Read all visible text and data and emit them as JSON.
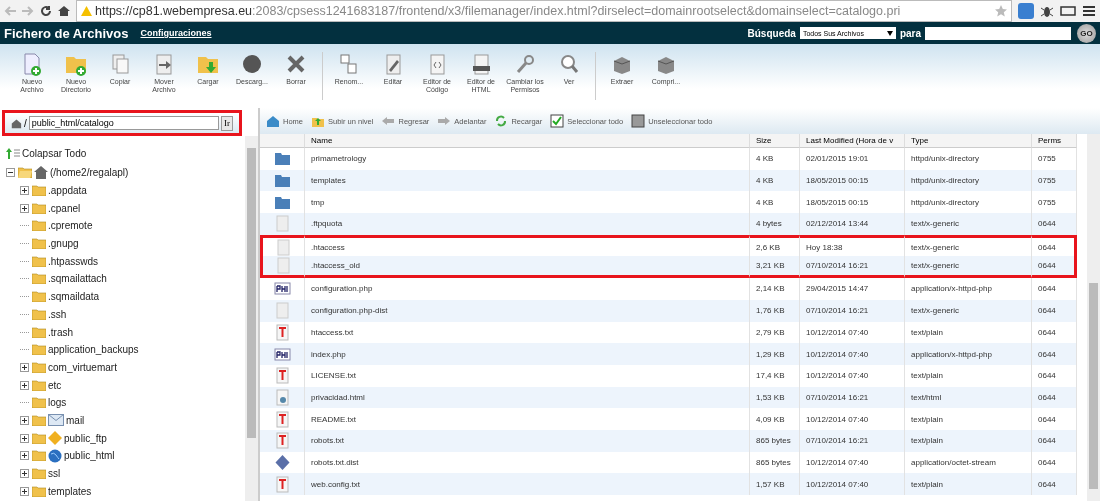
{
  "browser": {
    "url_host": "https://cp81.webempresa.eu",
    "url_rest": ":2083/cpsess1241683187/frontend/x3/filemanager/index.html?dirselect=domainrootselect&domainselect=catalogo.pri"
  },
  "header": {
    "title": "Fichero de Archivos",
    "settings_link": "Configuraciones",
    "search_label": "Búsqueda",
    "search_scope": "Todos Sus Archivos",
    "for_label": "para",
    "go": "GO"
  },
  "toolbar": [
    [
      {
        "kind": "new-file",
        "label": "Nuevo Archivo"
      },
      {
        "kind": "new-folder",
        "label": "Nuevo Directorio"
      },
      {
        "kind": "copy",
        "label": "Copiar"
      },
      {
        "kind": "move",
        "label": "Mover Archivo"
      },
      {
        "kind": "upload",
        "label": "Cargar"
      },
      {
        "kind": "download",
        "label": "Descarg..."
      },
      {
        "kind": "delete",
        "label": "Borrar"
      }
    ],
    [
      {
        "kind": "rename",
        "label": "Renom..."
      },
      {
        "kind": "edit",
        "label": "Editar"
      },
      {
        "kind": "code",
        "label": "Editor de Código"
      },
      {
        "kind": "html",
        "label": "Editor de HTML"
      },
      {
        "kind": "perms",
        "label": "Cambiar los Permisos"
      },
      {
        "kind": "view",
        "label": "Ver"
      }
    ],
    [
      {
        "kind": "extract",
        "label": "Extraer"
      },
      {
        "kind": "compress",
        "label": "Compri..."
      }
    ]
  ],
  "path_box": {
    "prefix": "/",
    "value": "public_html/catalogo",
    "go": "Ir",
    "highlighted": true
  },
  "tree": {
    "collapse_all": "Colapsar Todo",
    "root": {
      "label": "(/home2/regalapl)",
      "expanded": true,
      "children": [
        {
          "label": ".appdata",
          "kind": "folder",
          "expandable": true
        },
        {
          "label": ".cpanel",
          "kind": "folder",
          "expandable": true
        },
        {
          "label": ".cpremote",
          "kind": "folder",
          "expandable": false
        },
        {
          "label": ".gnupg",
          "kind": "folder",
          "expandable": false
        },
        {
          "label": ".htpasswds",
          "kind": "folder",
          "expandable": false
        },
        {
          "label": ".sqmailattach",
          "kind": "folder",
          "expandable": false
        },
        {
          "label": ".sqmaildata",
          "kind": "folder",
          "expandable": false
        },
        {
          "label": ".ssh",
          "kind": "folder",
          "expandable": false
        },
        {
          "label": ".trash",
          "kind": "folder",
          "expandable": false
        },
        {
          "label": "application_backups",
          "kind": "folder",
          "expandable": false
        },
        {
          "label": "com_virtuemart",
          "kind": "folder",
          "expandable": true
        },
        {
          "label": "etc",
          "kind": "folder",
          "expandable": true
        },
        {
          "label": "logs",
          "kind": "folder",
          "expandable": false
        },
        {
          "label": "mail",
          "kind": "mail",
          "expandable": true
        },
        {
          "label": "public_ftp",
          "kind": "ftp",
          "expandable": true
        },
        {
          "label": "public_html",
          "kind": "web",
          "expandable": true
        },
        {
          "label": "ssl",
          "kind": "folder",
          "expandable": true
        },
        {
          "label": "templates",
          "kind": "folder",
          "expandable": true
        }
      ]
    }
  },
  "nav": [
    {
      "kind": "home",
      "label": "Home"
    },
    {
      "kind": "up",
      "label": "Subir un nivel"
    },
    {
      "kind": "back",
      "label": "Regresar"
    },
    {
      "kind": "forward",
      "label": "Adelantar"
    },
    {
      "kind": "reload",
      "label": "Recargar"
    },
    {
      "kind": "select-all",
      "label": "Seleccionar todo"
    },
    {
      "kind": "unselect-all",
      "label": "Unseleccionar todo"
    }
  ],
  "table": {
    "columns": [
      "Name",
      "Size",
      "Last Modified (Hora de v",
      "Type",
      "Perms"
    ],
    "rows": [
      {
        "kind": "folder",
        "name": "primametrology",
        "size": "4 KB",
        "modified": "02/01/2015 19:01",
        "type": "httpd/unix-directory",
        "perms": "0755",
        "highlighted": false
      },
      {
        "kind": "folder",
        "name": "templates",
        "size": "4 KB",
        "modified": "18/05/2015 00:15",
        "type": "httpd/unix-directory",
        "perms": "0755",
        "highlighted": false
      },
      {
        "kind": "folder",
        "name": "tmp",
        "size": "4 KB",
        "modified": "18/05/2015 00:15",
        "type": "httpd/unix-directory",
        "perms": "0755",
        "highlighted": false
      },
      {
        "kind": "generic",
        "name": ".ftpquota",
        "size": "4 bytes",
        "modified": "02/12/2014 13:44",
        "type": "text/x-generic",
        "perms": "0644",
        "highlighted": false
      },
      {
        "kind": "generic",
        "name": ".htaccess",
        "size": "2,6 KB",
        "modified": "Hoy 18:38",
        "type": "text/x-generic",
        "perms": "0644",
        "highlighted": true
      },
      {
        "kind": "generic",
        "name": ".htaccess_old",
        "size": "3,21 KB",
        "modified": "07/10/2014 16:21",
        "type": "text/x-generic",
        "perms": "0644",
        "highlighted": true
      },
      {
        "kind": "php",
        "name": "configuration.php",
        "size": "2,14 KB",
        "modified": "29/04/2015 14:47",
        "type": "application/x-httpd-php",
        "perms": "0644",
        "highlighted": false
      },
      {
        "kind": "generic",
        "name": "configuration.php-dist",
        "size": "1,76 KB",
        "modified": "07/10/2014 16:21",
        "type": "text/x-generic",
        "perms": "0644",
        "highlighted": false
      },
      {
        "kind": "text",
        "name": "htaccess.txt",
        "size": "2,79 KB",
        "modified": "10/12/2014 07:40",
        "type": "text/plain",
        "perms": "0644",
        "highlighted": false
      },
      {
        "kind": "php",
        "name": "index.php",
        "size": "1,29 KB",
        "modified": "10/12/2014 07:40",
        "type": "application/x-httpd-php",
        "perms": "0644",
        "highlighted": false
      },
      {
        "kind": "text",
        "name": "LICENSE.txt",
        "size": "17,4 KB",
        "modified": "10/12/2014 07:40",
        "type": "text/plain",
        "perms": "0644",
        "highlighted": false
      },
      {
        "kind": "html",
        "name": "privacidad.html",
        "size": "1,53 KB",
        "modified": "07/10/2014 16:21",
        "type": "text/html",
        "perms": "0644",
        "highlighted": false
      },
      {
        "kind": "text",
        "name": "README.txt",
        "size": "4,09 KB",
        "modified": "10/12/2014 07:40",
        "type": "text/plain",
        "perms": "0644",
        "highlighted": false
      },
      {
        "kind": "text",
        "name": "robots.txt",
        "size": "865 bytes",
        "modified": "07/10/2014 16:21",
        "type": "text/plain",
        "perms": "0644",
        "highlighted": false
      },
      {
        "kind": "binary",
        "name": "robots.txt.dist",
        "size": "865 bytes",
        "modified": "10/12/2014 07:40",
        "type": "application/octet-stream",
        "perms": "0644",
        "highlighted": false
      },
      {
        "kind": "text",
        "name": "web.config.txt",
        "size": "1,57 KB",
        "modified": "10/12/2014 07:40",
        "type": "text/plain",
        "perms": "0644",
        "highlighted": false
      }
    ]
  }
}
